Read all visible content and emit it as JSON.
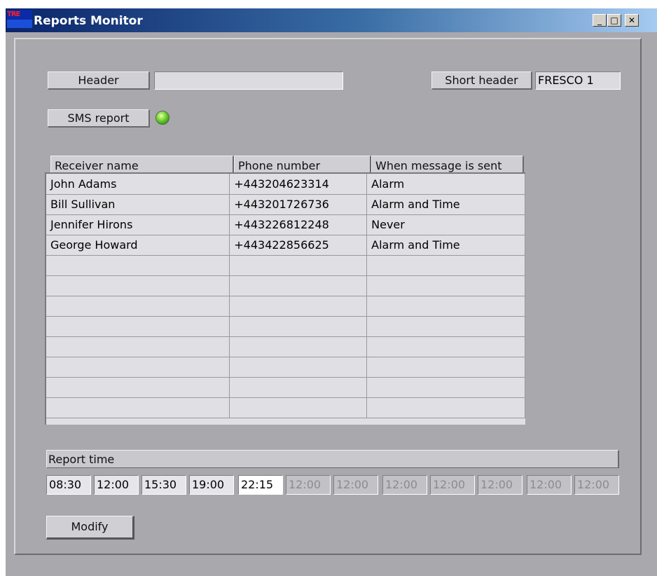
{
  "window": {
    "title": "Reports Monitor",
    "app_icon_text": "TRE",
    "controls": {
      "minimize": "_",
      "maximize": "□",
      "close": "✕"
    }
  },
  "header": {
    "button_label": "Header",
    "value": "",
    "short_header_label": "Short header",
    "short_header_value": "FRESCO 1"
  },
  "sms_report": {
    "button_label": "SMS report",
    "status": "on",
    "led_color": "#6cd02a"
  },
  "receivers_table": {
    "columns": [
      "Receiver name",
      "Phone number",
      "When message is sent"
    ],
    "rows": [
      [
        "John Adams",
        "+443204623314",
        "Alarm"
      ],
      [
        "Bill Sullivan",
        "+443201726736",
        "Alarm and Time"
      ],
      [
        "Jennifer Hirons",
        "+443226812248",
        "Never"
      ],
      [
        "George Howard",
        "+443422856625",
        "Alarm and Time"
      ]
    ],
    "empty_rows": 8
  },
  "report_time": {
    "label": "Report time",
    "times": [
      {
        "value": "08:30",
        "state": "on"
      },
      {
        "value": "12:00",
        "state": "on"
      },
      {
        "value": "15:30",
        "state": "on"
      },
      {
        "value": "19:00",
        "state": "on"
      },
      {
        "value": "22:15",
        "state": "sel"
      },
      {
        "value": "12:00",
        "state": "off"
      },
      {
        "value": "12:00",
        "state": "off"
      },
      {
        "value": "12:00",
        "state": "off"
      },
      {
        "value": "12:00",
        "state": "off"
      },
      {
        "value": "12:00",
        "state": "off"
      },
      {
        "value": "12:00",
        "state": "off"
      },
      {
        "value": "12:00",
        "state": "off"
      }
    ]
  },
  "actions": {
    "modify_label": "Modify"
  }
}
